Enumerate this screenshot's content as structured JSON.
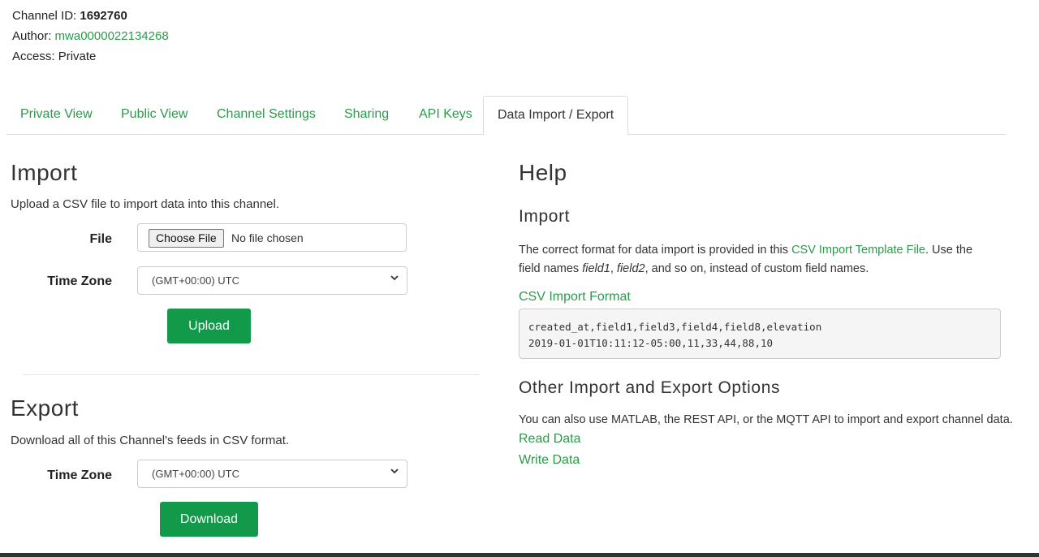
{
  "meta": {
    "channel_id_label": "Channel ID:",
    "channel_id": "1692760",
    "author_label": "Author:",
    "author": "mwa0000022134268",
    "access_label": "Access:",
    "access": "Private"
  },
  "tabs": [
    {
      "label": "Private View"
    },
    {
      "label": "Public View"
    },
    {
      "label": "Channel Settings"
    },
    {
      "label": "Sharing"
    },
    {
      "label": "API Keys"
    },
    {
      "label": "Data Import / Export",
      "active": true
    }
  ],
  "import": {
    "title": "Import",
    "description": "Upload a CSV file to import data into this channel.",
    "file_label": "File",
    "choose_file": "Choose File",
    "no_file": "No file chosen",
    "timezone_label": "Time Zone",
    "timezone_value": "(GMT+00:00) UTC",
    "upload_button": "Upload"
  },
  "export": {
    "title": "Export",
    "description": "Download all of this Channel's feeds in CSV format.",
    "timezone_label": "Time Zone",
    "timezone_value": "(GMT+00:00) UTC",
    "download_button": "Download"
  },
  "help": {
    "title": "Help",
    "import_title": "Import",
    "import_text_1": "The correct format for data import is provided in this ",
    "template_link": "CSV Import Template File",
    "import_text_2": ". Use the",
    "import_text_3": "field names ",
    "field1": "field1",
    "comma": ", ",
    "field2": "field2",
    "import_text_4": ", and so on, instead of custom field names.",
    "csv_format_link": "CSV Import Format",
    "code_line_1": "created_at,field1,field3,field4,field8,elevation",
    "code_line_2": "2019-01-01T10:11:12-05:00,11,33,44,88,10",
    "other_title": "Other Import and Export Options",
    "other_text": "You can also use MATLAB, the REST API, or the MQTT API to import and export channel data.",
    "read_data_link": "Read Data",
    "write_data_link": "Write Data"
  },
  "colors": {
    "link_green": "#2b9a4a",
    "button_green": "#12994a"
  }
}
